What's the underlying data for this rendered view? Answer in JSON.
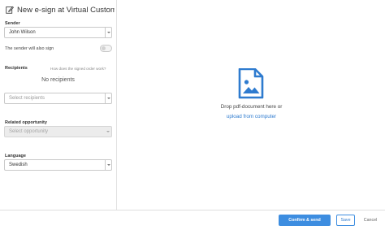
{
  "header": {
    "title": "New e-sign at Virtual Customer ...",
    "icon": "edit-icon"
  },
  "sender": {
    "label": "Sender",
    "value": "John Wilson",
    "also_sign_label": "The sender will also sign",
    "also_sign_checked": false
  },
  "recipients": {
    "label": "Recipients",
    "help_link": "How does the signed order work?",
    "empty_text": "No recipients",
    "select_placeholder": "Select recipients"
  },
  "related_opportunity": {
    "label": "Related opportunity",
    "placeholder": "Select opportunity",
    "disabled": true
  },
  "language": {
    "label": "Language",
    "value": "Swedish"
  },
  "dropzone": {
    "icon": "pdf-document-icon",
    "text": "Drop pdf-document here or",
    "link": "upload from computer"
  },
  "footer": {
    "confirm_label": "Confirm & send",
    "save_label": "Save",
    "cancel_label": "Cancel"
  },
  "colors": {
    "accent": "#3d8de0",
    "link": "#2e7bcf",
    "disabled_bg": "#ececec"
  }
}
